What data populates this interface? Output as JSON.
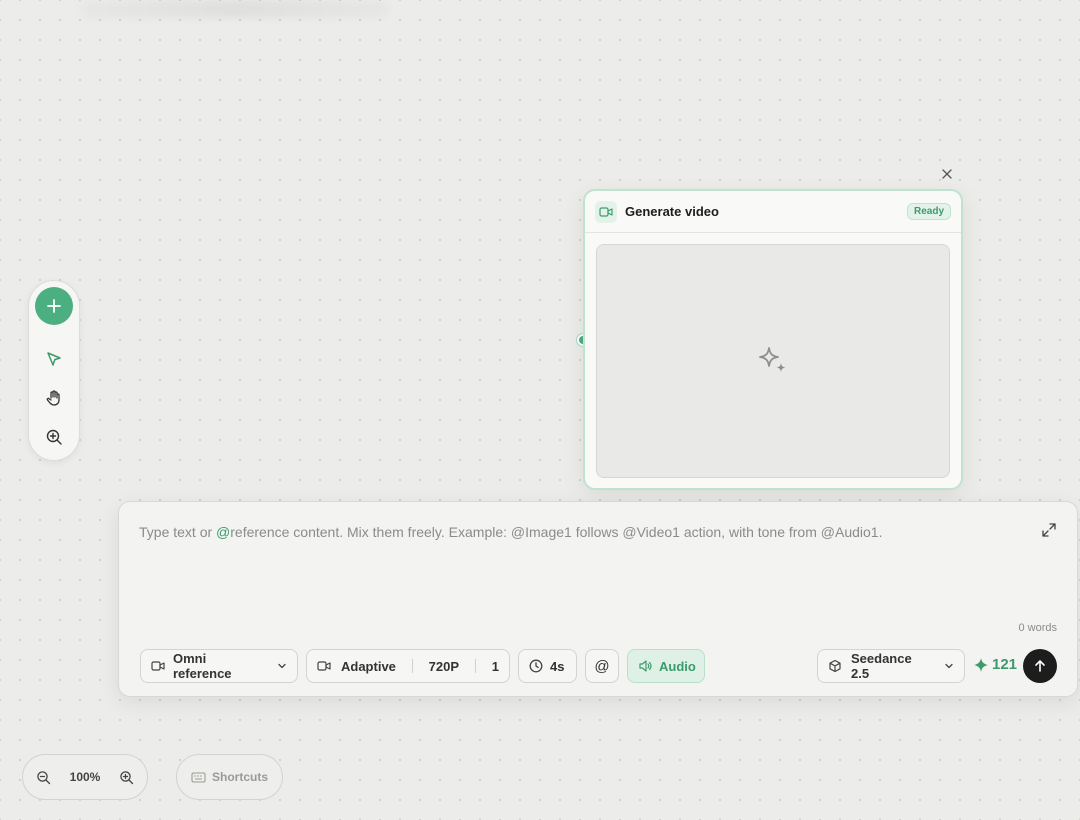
{
  "node": {
    "title": "Generate video",
    "status": "Ready",
    "icon": "video-camera-icon",
    "preview_icon": "sparkles-icon"
  },
  "prompt": {
    "placeholder_prefix": "Type text or ",
    "placeholder_at": "@",
    "placeholder_rest": "reference content. Mix them freely. Example: @Image1 follows @Video1 action, with tone from @Audio1.",
    "word_count": "0 words"
  },
  "controls": {
    "reference_mode": "Omni reference",
    "ratio": "Adaptive",
    "resolution": "720P",
    "count": "1",
    "duration": "4s",
    "mention_symbol": "@",
    "audio": "Audio",
    "model": "Seedance 2.5",
    "credits": "121"
  },
  "zoom": {
    "level": "100%"
  },
  "shortcuts": {
    "label": "Shortcuts"
  },
  "colors": {
    "accent": "#4caf82",
    "accent_text": "#3c9a6b",
    "send_button": "#1d1d1d"
  }
}
